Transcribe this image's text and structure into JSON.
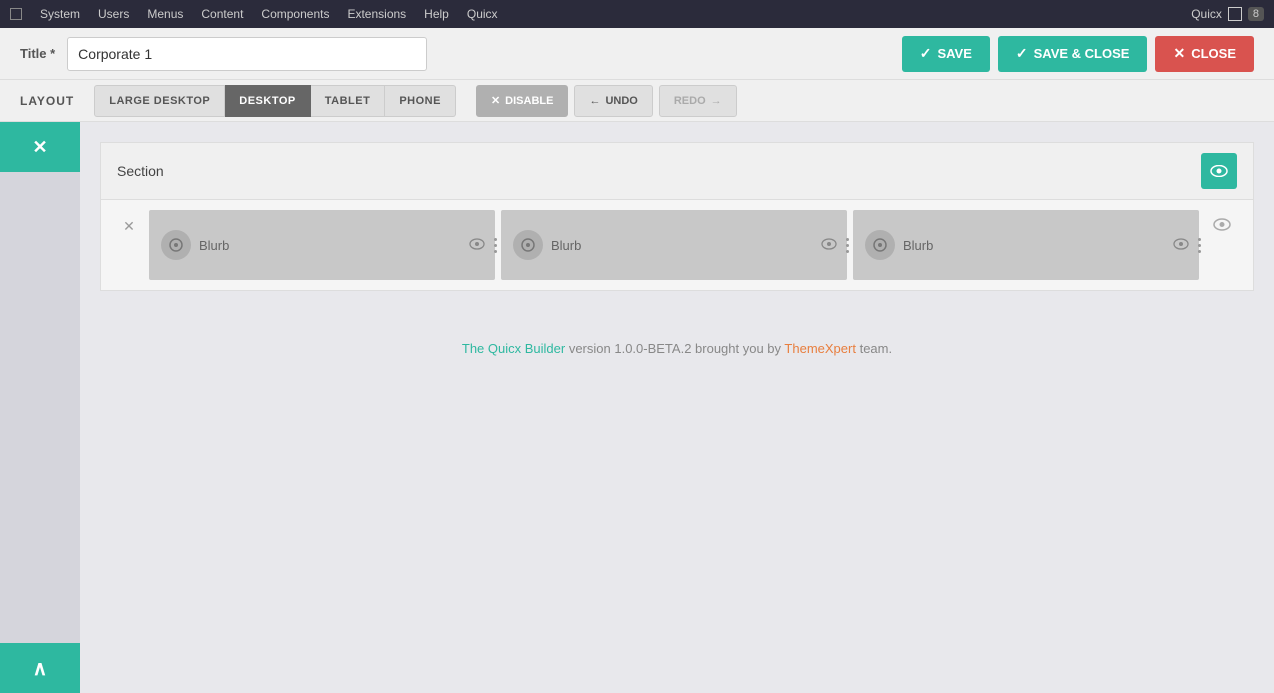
{
  "nav": {
    "items": [
      "System",
      "Users",
      "Menus",
      "Content",
      "Components",
      "Extensions",
      "Help",
      "Quicx"
    ],
    "logo": "Quicx",
    "badge": "8"
  },
  "header": {
    "title_label": "Title *",
    "title_value": "Corporate 1",
    "save_label": "SAVE",
    "save_close_label": "SAVE & CLOSE",
    "close_label": "CLOSE"
  },
  "toolbar": {
    "layout_label": "LAYOUT",
    "device_buttons": [
      "LARGE DESKTOP",
      "DESKTOP",
      "TABLET",
      "PHONE"
    ],
    "disable_label": "DISABLE",
    "undo_label": "UNDO",
    "redo_label": "REDO"
  },
  "section": {
    "title": "Section"
  },
  "blurbs": [
    {
      "label": "Blurb"
    },
    {
      "label": "Blurb"
    },
    {
      "label": "Blurb"
    }
  ],
  "footer": {
    "builder_link": "The Quicx Builder",
    "middle_text": " version 1.0.0-BETA.2 brought you by ",
    "theme_link": "ThemeXpert",
    "end_text": " team."
  },
  "icons": {
    "check": "✓",
    "x": "✕",
    "arrow_left": "←",
    "arrow_right": "→",
    "eye": "👁",
    "chevron_up": "^",
    "drag": "⋮"
  }
}
